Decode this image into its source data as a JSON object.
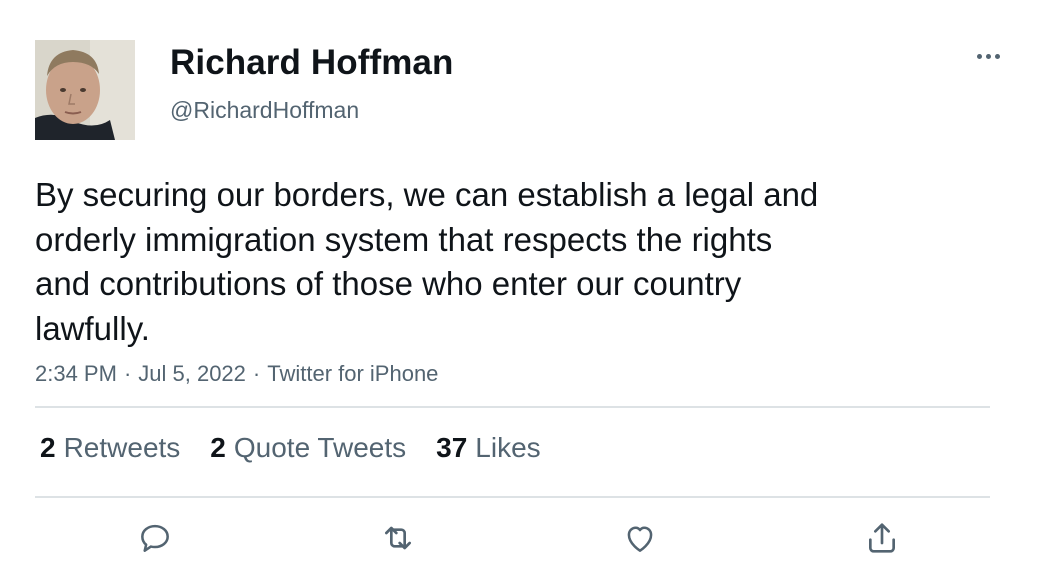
{
  "user": {
    "display_name": "Richard Hoffman",
    "handle": "@RichardHoffman"
  },
  "tweet": {
    "lines": [
      "By securing our borders, we can establish a legal and",
      "orderly immigration system that respects the rights",
      "and contributions of those who enter our country",
      "lawfully."
    ],
    "time": "2:34 PM",
    "date": "Jul 5, 2022",
    "source": "Twitter for iPhone",
    "separator": "·"
  },
  "stats": {
    "retweets": {
      "count": "2",
      "label": "Retweets"
    },
    "quotes": {
      "count": "2",
      "label": "Quote Tweets"
    },
    "likes": {
      "count": "37",
      "label": "Likes"
    }
  },
  "actions": [
    "reply-icon",
    "retweet-icon",
    "like-icon",
    "share-icon"
  ],
  "colors": {
    "text": "#0f1419",
    "secondary": "#536471",
    "divider": "#dde2e5"
  }
}
